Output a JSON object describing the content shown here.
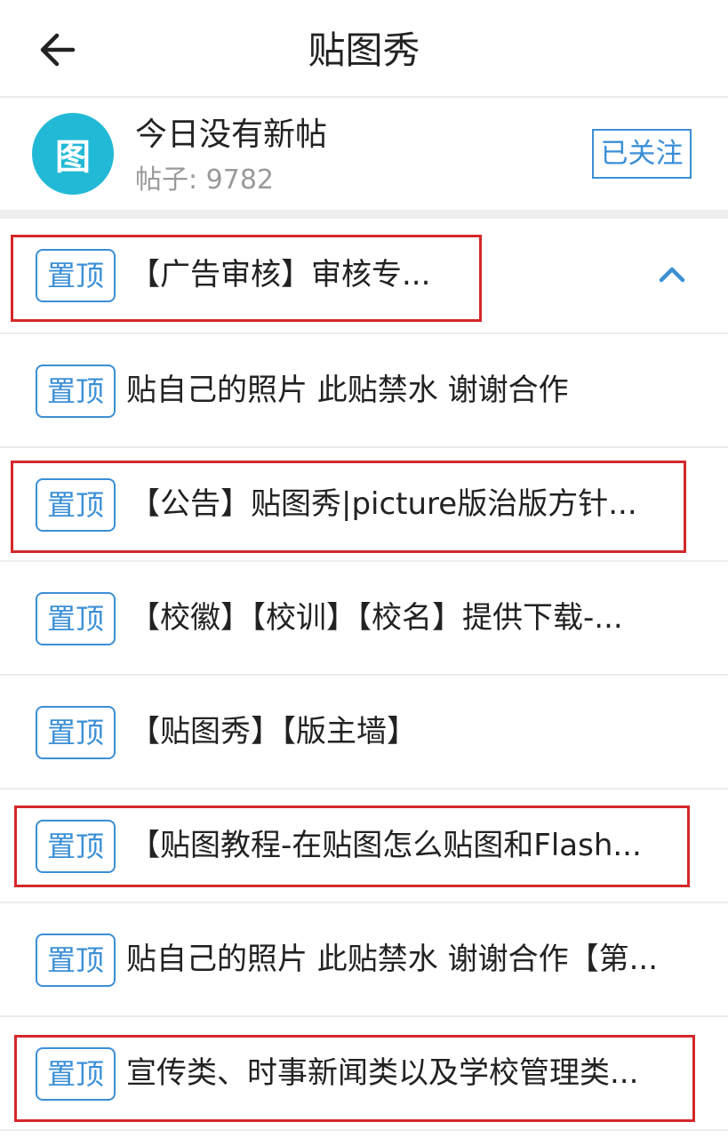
{
  "header": {
    "title": "贴图秀",
    "back_icon": "arrow-left-icon"
  },
  "forum": {
    "avatar_text": "图",
    "status": "今日没有新帖",
    "post_count": "帖子: 9782",
    "follow_label": "已关注"
  },
  "colors": {
    "accent": "#3b8fd6",
    "avatar_bg": "#22b9d6",
    "highlight": "#d4282c"
  },
  "pinned": {
    "collapse_icon": "chevron-up-icon",
    "items": [
      {
        "badge": "置顶",
        "title": "【广告审核】审核专..."
      },
      {
        "badge": "置顶",
        "title": "贴自己的照片 此贴禁水 谢谢合作"
      },
      {
        "badge": "置顶",
        "title": "【公告】贴图秀|picture版治版方针..."
      },
      {
        "badge": "置顶",
        "title": "【校徽】【校训】【校名】提供下载-..."
      },
      {
        "badge": "置顶",
        "title": "【贴图秀】【版主墙】"
      },
      {
        "badge": "置顶",
        "title": "【贴图教程-在贴图怎么贴图和Flash..."
      },
      {
        "badge": "置顶",
        "title": "贴自己的照片 此贴禁水 谢谢合作【第..."
      },
      {
        "badge": "置顶",
        "title": "宣传类、时事新闻类以及学校管理类..."
      }
    ]
  }
}
